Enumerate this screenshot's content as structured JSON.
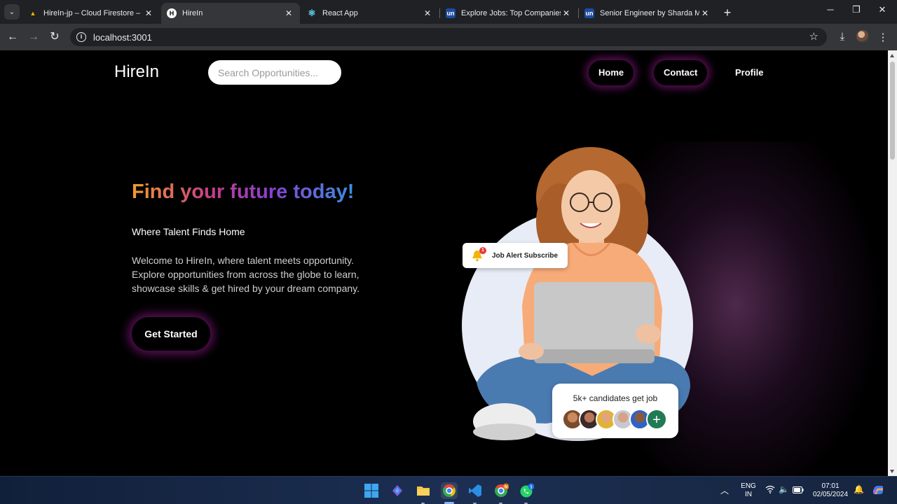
{
  "browser": {
    "tabs": [
      {
        "title": "HireIn-jp – Cloud Firestore – Da",
        "favicon": "firebase-icon",
        "active": false
      },
      {
        "title": "HireIn",
        "favicon": "hirein-icon",
        "active": true
      },
      {
        "title": "React App",
        "favicon": "react-icon",
        "active": false
      },
      {
        "title": "Explore Jobs: Top Companies A",
        "favicon": "unstop-icon",
        "active": false
      },
      {
        "title": "Senior Engineer by Sharda Mot",
        "favicon": "unstop-icon",
        "active": false
      }
    ],
    "tab_close_glyph": "✕",
    "new_tab_glyph": "+",
    "url": "localhost:3001"
  },
  "page": {
    "logo": "HireIn",
    "search_placeholder": "Search Opportunities...",
    "nav": [
      {
        "label": "Home"
      },
      {
        "label": "Contact"
      },
      {
        "label": "Profile"
      }
    ],
    "hero": {
      "title": "Find your future today!",
      "subtitle": "Where Talent Finds Home",
      "description": "Welcome to HireIn, where talent meets opportunity. Explore opportunities from across the globe to learn, showcase skills & get hired by your dream company.",
      "cta": "Get Started"
    },
    "illustration": {
      "alert_card": "Job Alert Subscribe",
      "alert_badge": "1",
      "candidates_card": "5k+ candidates get job",
      "plus_glyph": "+"
    }
  },
  "taskbar": {
    "lang_top": "ENG",
    "lang_bottom": "IN",
    "time": "07:01",
    "date": "02/05/2024",
    "chrome_badge": "N",
    "whatsapp_badge": "1"
  },
  "colors": {
    "accent_glow": "#aa1ea0",
    "title_gradient": [
      "#f39c2a",
      "#c43f86",
      "#8a3fcf",
      "#3b8fe0"
    ],
    "page_bg": "#000000"
  }
}
